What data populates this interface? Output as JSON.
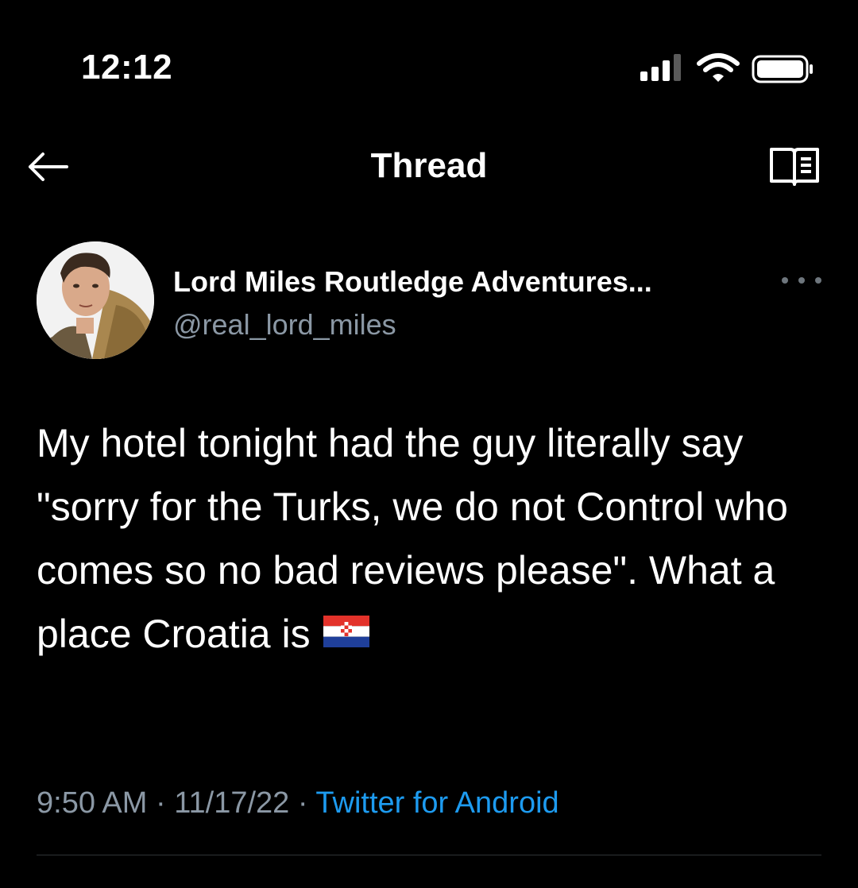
{
  "status_bar": {
    "time": "12:12",
    "icons": [
      "cellular-signal-icon",
      "wifi-icon",
      "battery-icon"
    ]
  },
  "nav": {
    "title": "Thread",
    "back_icon": "arrow-left-icon",
    "reader_icon": "reader-mode-icon"
  },
  "tweet": {
    "author": {
      "display_name": "Lord Miles Routledge Adventures...",
      "handle": "@real_lord_miles"
    },
    "text": "My hotel tonight had the guy literally say \"sorry for the Turks, we do not Control who comes so no bad reviews please\". What a place Croatia is",
    "emoji": "croatia-flag-icon",
    "time": "9:50 AM",
    "date": "11/17/22",
    "separator": "·",
    "source": "Twitter for Android"
  },
  "colors": {
    "background": "#000000",
    "text_primary": "#ffffff",
    "text_secondary": "#8b98a5",
    "link": "#1d9bf0",
    "divider": "#2f3336"
  }
}
